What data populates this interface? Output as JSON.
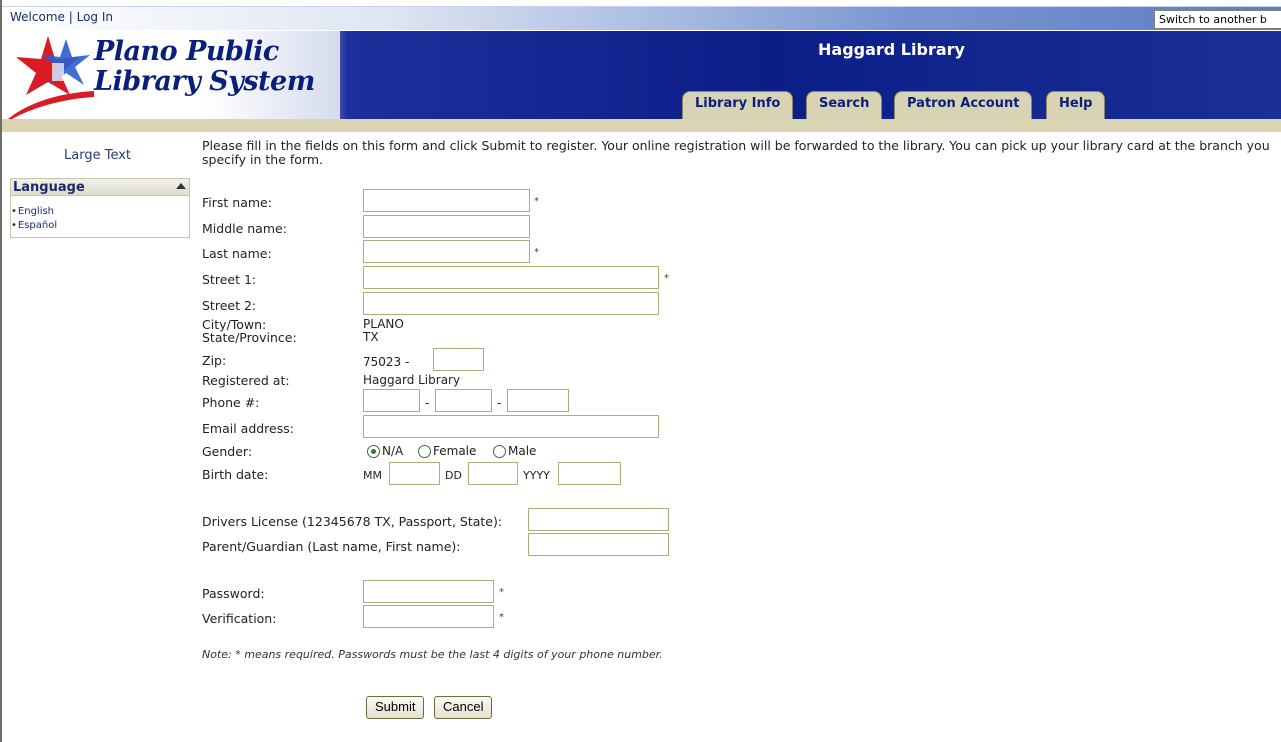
{
  "topbar": {
    "welcome": "Welcome",
    "separator": "|",
    "login": "Log In",
    "switch_branch": "Switch to another b"
  },
  "header": {
    "logo_line1": "Plano Public",
    "logo_line2": "Library System",
    "branch": "Haggard Library",
    "tabs": [
      "Library Info",
      "Search",
      "Patron Account",
      "Help"
    ]
  },
  "sidebar": {
    "large_text": "Large Text",
    "language_title": "Language",
    "languages": [
      "English",
      "Español"
    ]
  },
  "form": {
    "intro": "Please fill in the fields on this form and click Submit to register. Your online registration will be forwarded to the library. You can pick up your library card at the branch you specify in the form.",
    "first_name": "First name:",
    "middle_name": "Middle name:",
    "last_name": "Last name:",
    "street1": "Street 1:",
    "street2": "Street 2:",
    "city_label": "City/Town:",
    "city_value": "PLANO",
    "state_label": "State/Province:",
    "state_value": "TX",
    "zip_label": "Zip:",
    "zip_value": "75023 -",
    "registered_label": "Registered at:",
    "registered_value": "Haggard Library",
    "phone_label": "Phone #:",
    "phone_sep": "-",
    "email_label": "Email address:",
    "gender_label": "Gender:",
    "gender_options": [
      "N/A",
      "Female",
      "Male"
    ],
    "gender_selected": "N/A",
    "birth_label": "Birth date:",
    "birth_mm": "MM",
    "birth_dd": "DD",
    "birth_yyyy": "YYYY",
    "license_label": "Drivers License (12345678 TX, Passport, State):",
    "guardian_label": "Parent/Guardian (Last name, First name):",
    "password_label": "Password:",
    "verification_label": "Verification:",
    "required_mark": "*",
    "note": "Note: * means required. Passwords must be the last 4 digits of your phone number.",
    "submit": "Submit",
    "cancel": "Cancel"
  }
}
